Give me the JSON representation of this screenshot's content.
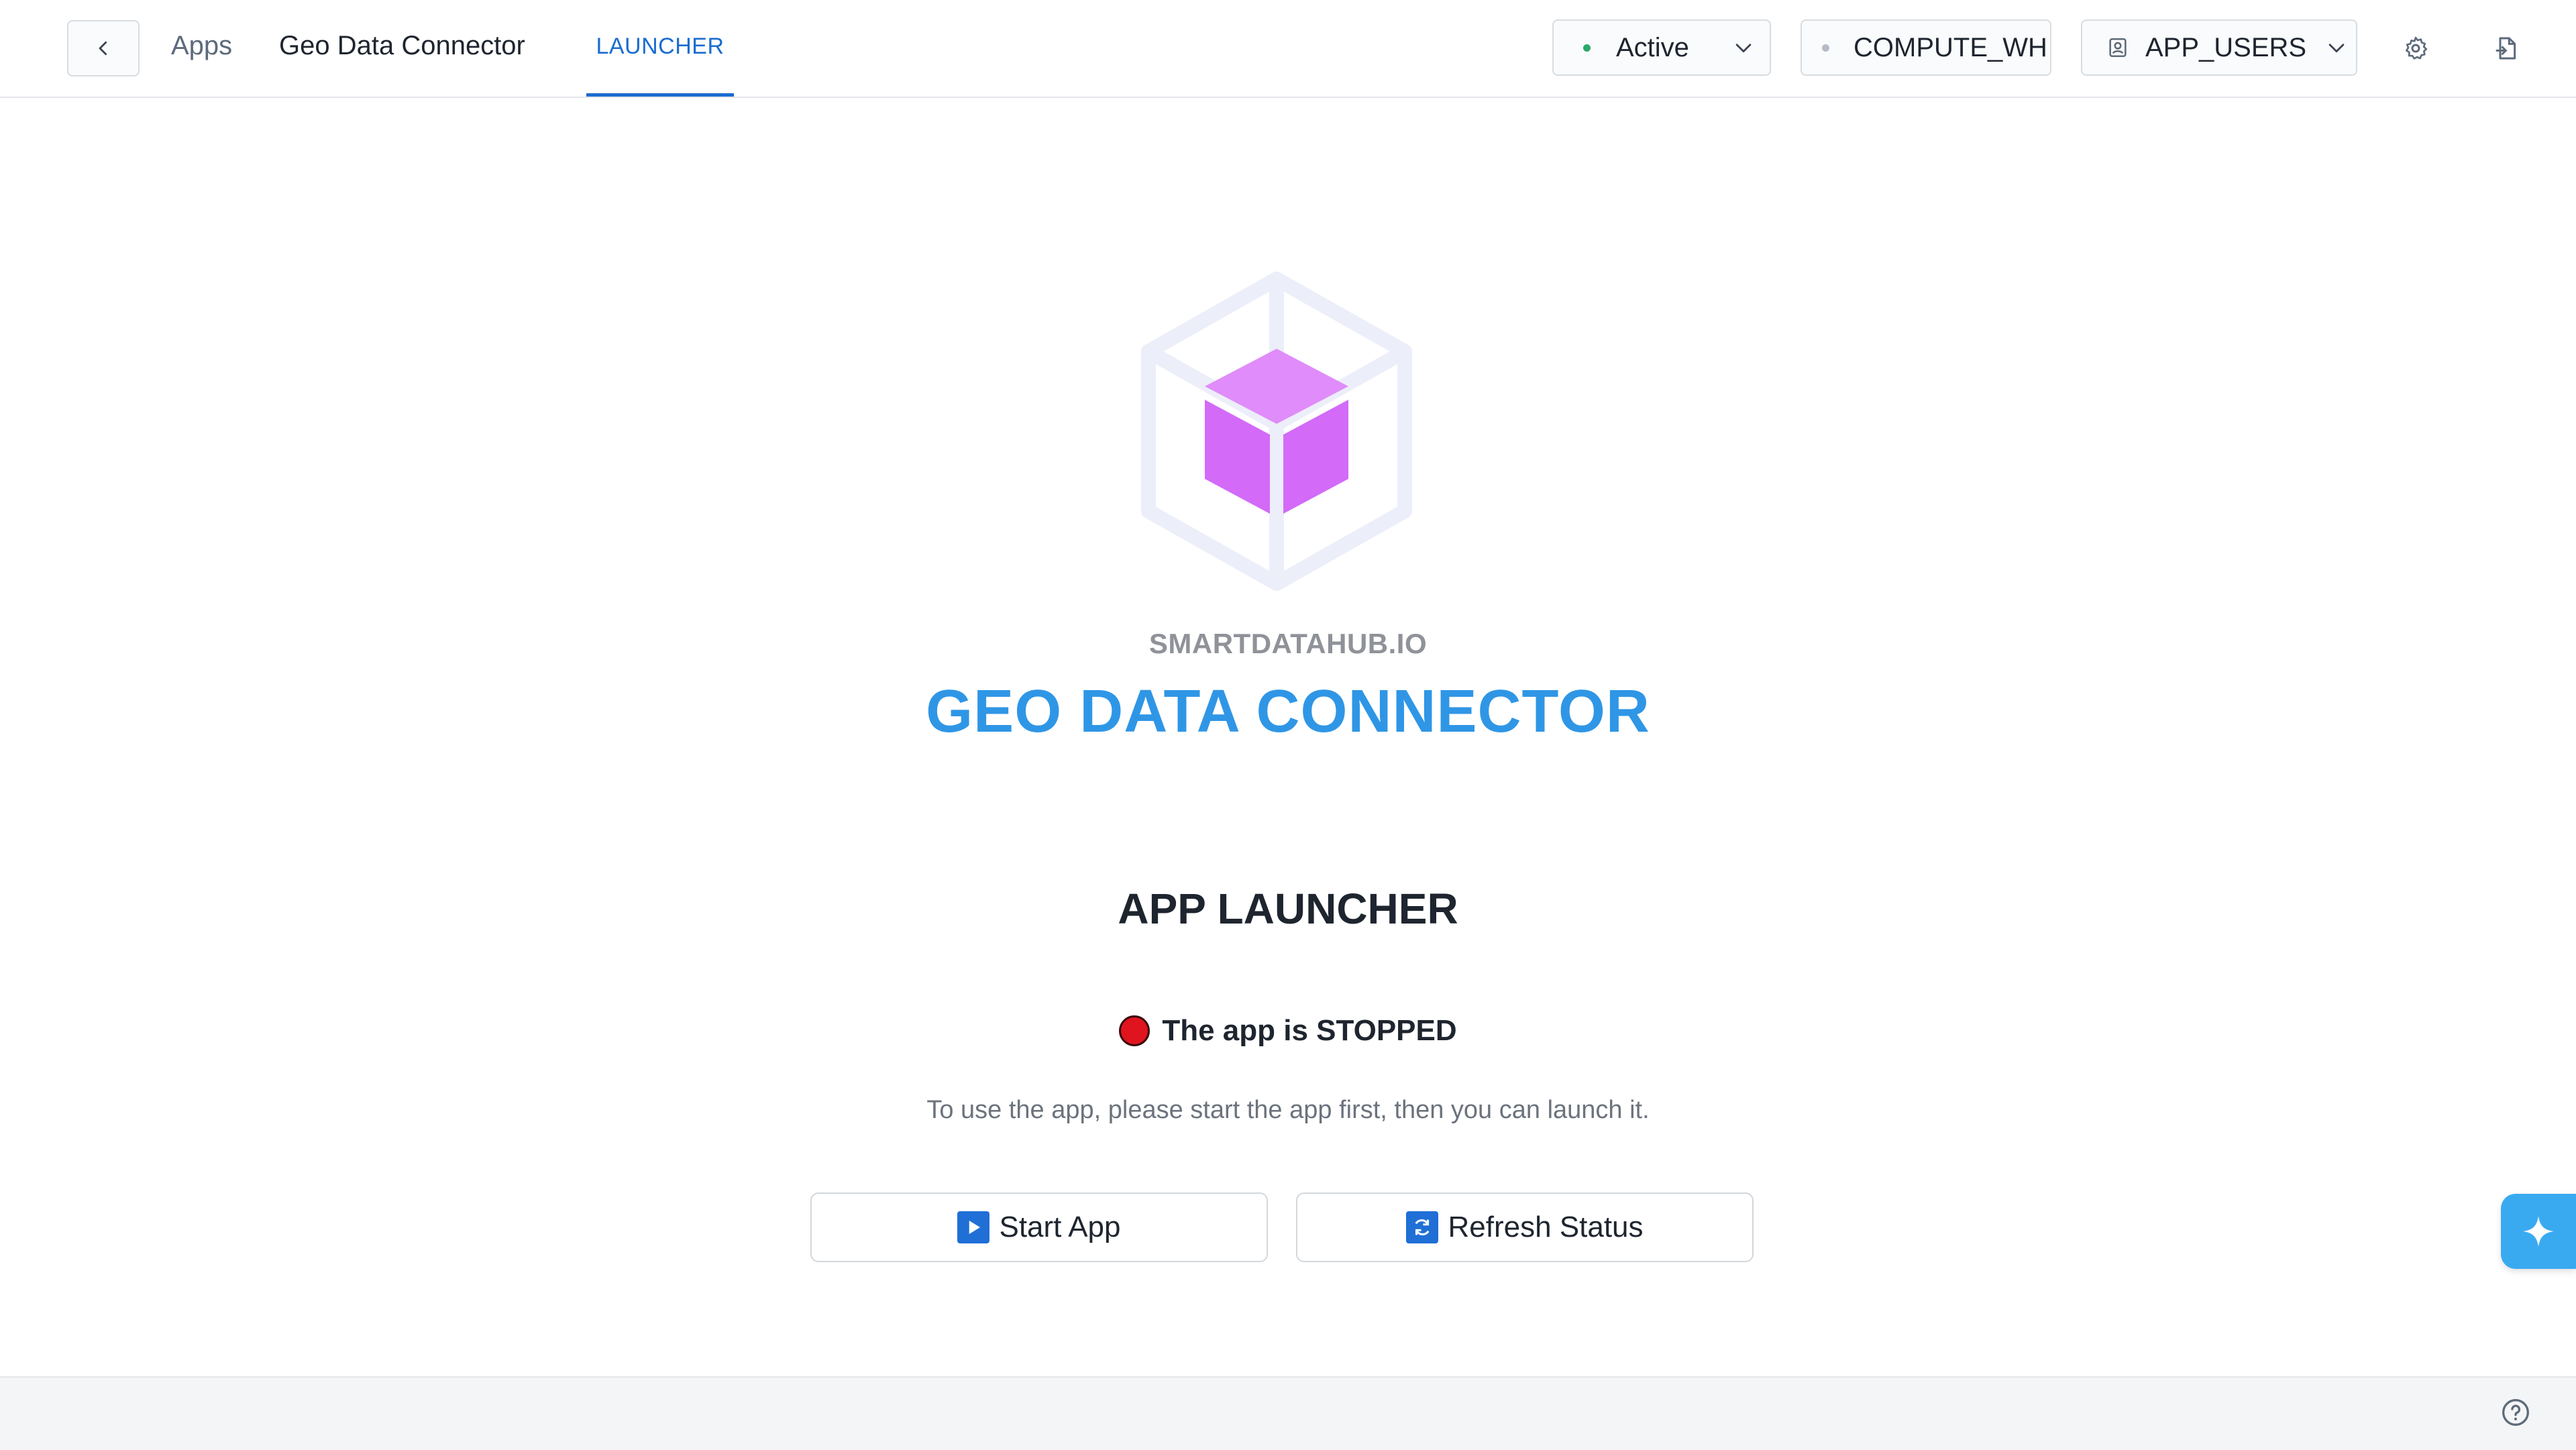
{
  "header": {
    "breadcrumb_apps": "Apps",
    "app_name": "Geo Data Connector",
    "tab_launcher": "LAUNCHER",
    "status": "Active",
    "warehouse": "COMPUTE_WH",
    "role": "APP_USERS"
  },
  "main": {
    "vendor": "SMARTDATAHUB.IO",
    "title": "GEO DATA CONNECTOR",
    "section_title": "APP LAUNCHER",
    "status_text": "The app is STOPPED",
    "hint": "To use the app, please start the app first, then you can launch it.",
    "start_button": "Start App",
    "refresh_button": "Refresh Status"
  },
  "colors": {
    "accent": "#1a6cd0",
    "title_blue": "#2f96e6",
    "cube": "#d36af8",
    "stopped_red": "#e0141e",
    "active_green": "#2aa86a"
  },
  "icons": [
    "chevron-left-icon",
    "chevron-down-icon",
    "user-role-icon",
    "gear-icon",
    "document-icon",
    "play-icon",
    "refresh-icon",
    "sparkle-icon",
    "help-icon"
  ]
}
